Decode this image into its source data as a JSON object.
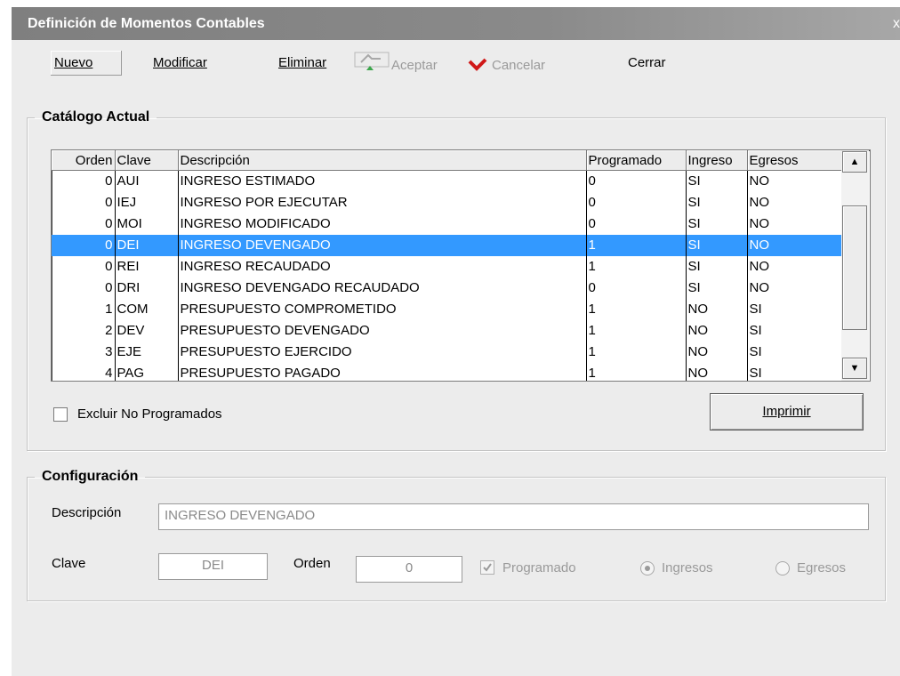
{
  "window": {
    "title": "Definición de Momentos Contables",
    "close_glyph": "x"
  },
  "toolbar": {
    "nuevo": "Nuevo",
    "modificar": "Modificar",
    "eliminar": "Eliminar",
    "aceptar": "Aceptar",
    "cancelar": "Cancelar",
    "cerrar": "Cerrar"
  },
  "catalogo": {
    "legend": "Catálogo Actual",
    "columns": [
      "Orden",
      "Clave",
      "Descripción",
      "Programado",
      "Ingreso",
      "Egresos"
    ],
    "rows": [
      [
        "0",
        "AUI",
        "INGRESO ESTIMADO",
        "0",
        "SI",
        "NO"
      ],
      [
        "0",
        "IEJ",
        "INGRESO POR EJECUTAR",
        "0",
        "SI",
        "NO"
      ],
      [
        "0",
        "MOI",
        "INGRESO MODIFICADO",
        "0",
        "SI",
        "NO"
      ],
      [
        "0",
        "DEI",
        "INGRESO DEVENGADO",
        "1",
        "SI",
        "NO"
      ],
      [
        "0",
        "REI",
        "INGRESO RECAUDADO",
        "1",
        "SI",
        "NO"
      ],
      [
        "0",
        "DRI",
        "INGRESO DEVENGADO RECAUDADO",
        "0",
        "SI",
        "NO"
      ],
      [
        "1",
        "COM",
        "PRESUPUESTO COMPROMETIDO",
        "1",
        "NO",
        "SI"
      ],
      [
        "2",
        "DEV",
        "PRESUPUESTO DEVENGADO",
        "1",
        "NO",
        "SI"
      ],
      [
        "3",
        "EJE",
        "PRESUPUESTO EJERCIDO",
        "1",
        "NO",
        "SI"
      ],
      [
        "4",
        "PAG",
        "PRESUPUESTO PAGADO",
        "1",
        "NO",
        "SI"
      ]
    ],
    "selected_row": 3,
    "excluir_label": "Excluir No Programados",
    "imprimir": "Imprimir"
  },
  "config": {
    "legend": "Configuración",
    "descripcion_label": "Descripción",
    "descripcion_value": "INGRESO DEVENGADO",
    "clave_label": "Clave",
    "clave_value": "DEI",
    "orden_label": "Orden",
    "orden_value": "0",
    "programado_label": "Programado",
    "programado_checked": true,
    "ingresos_label": "Ingresos",
    "egresos_label": "Egresos",
    "selected_radio": "Ingresos"
  },
  "colors": {
    "selection": "#3399ff",
    "titlebar": "#8a8a8a",
    "window_bg": "#ececec"
  }
}
